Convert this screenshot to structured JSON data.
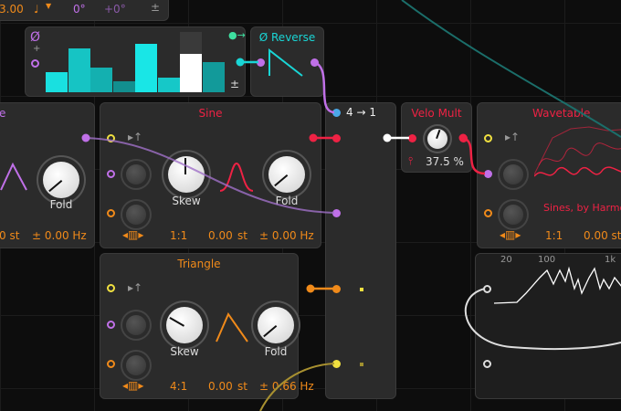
{
  "top_panel": {
    "value": "3.00",
    "note_icon": "quarter-note-icon",
    "phase": "0°",
    "phase_offset": "+0°",
    "bipolar": "±"
  },
  "step_seq": {
    "phase_icon": "Ø",
    "plus": "+",
    "bipolar": "±",
    "steps": [
      0.36,
      0.77,
      0.43,
      0.19,
      0.85,
      0.26,
      0.68,
      0.53
    ],
    "colors": {
      "bar": "#19d6d6",
      "active": "#ffffff"
    }
  },
  "reverse": {
    "title": "Ø Reverse"
  },
  "left_module": {
    "title": "e",
    "knob_label": "Fold",
    "pitch": "0 st",
    "freq": "± 0.00 Hz"
  },
  "sine": {
    "title": "Sine",
    "skew_label": "Skew",
    "fold_label": "Fold",
    "ratio": "1:1",
    "pitch": "0.00",
    "pitch_unit": "st",
    "freq": "± 0.00 Hz",
    "color": "#ee2244"
  },
  "merge": {
    "title": "4 → 1"
  },
  "velo_mult": {
    "title": "Velo Mult",
    "value": "37.5 %"
  },
  "wavetable": {
    "title": "Wavetable",
    "table_name": "Sines, by Harmonic",
    "ratio": "1:1",
    "pitch": "0.00 st"
  },
  "triangle": {
    "title": "Triangle",
    "skew_label": "Skew",
    "fold_label": "Fold",
    "ratio": "4:1",
    "pitch": "0.00",
    "pitch_unit": "st",
    "freq": "± 0.66 Hz",
    "color": "#f08a1a"
  },
  "spectrum": {
    "ticks": [
      "20",
      "100",
      "1k"
    ]
  },
  "colors": {
    "accent_orange": "#f08a1a",
    "purple": "#c070e8",
    "cyan": "#19d6d6",
    "red": "#ee2244",
    "yellow": "#f0e040"
  }
}
